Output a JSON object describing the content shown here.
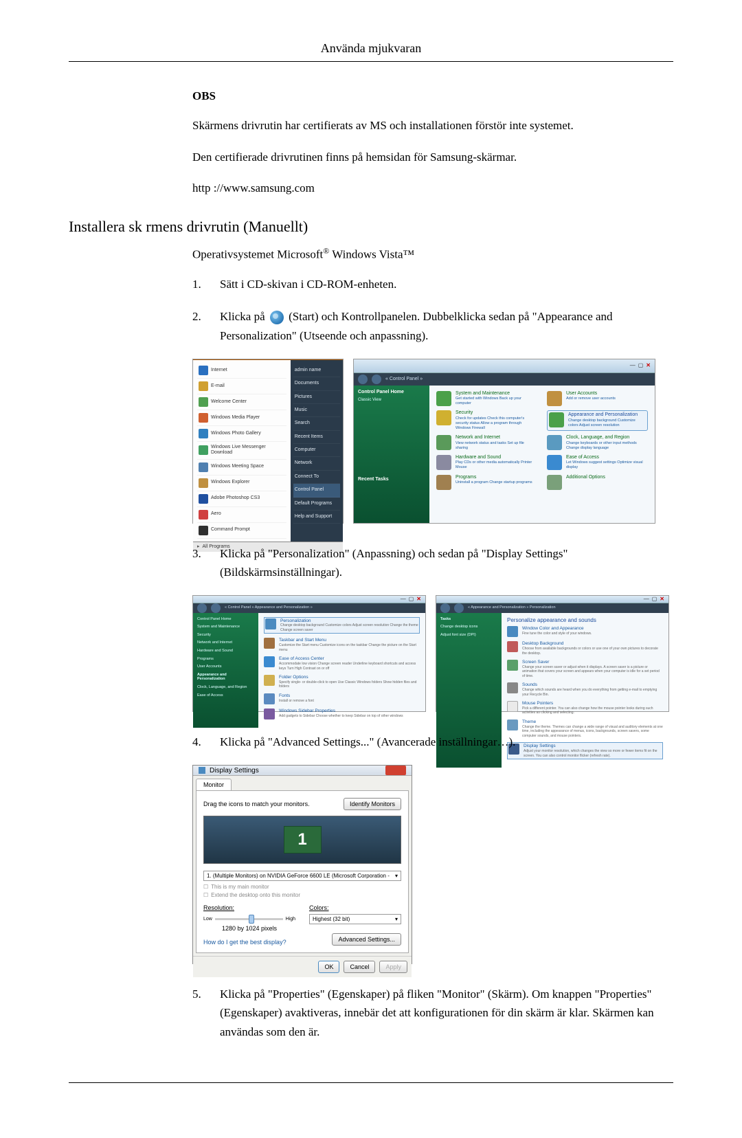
{
  "header": {
    "title": "Använda mjukvaran"
  },
  "obs": {
    "heading": "OBS"
  },
  "p1": "Skärmens drivrutin har certifierats av MS och installationen förstör inte systemet.",
  "p2": "Den certifierade drivrutinen finns på hemsidan för Samsung-skärmar.",
  "p3": "http ://www.samsung.com",
  "h2": "Installera sk rmens drivrutin (Manuellt)",
  "os_prefix": "Operativsystemet Microsoft",
  "os_suffix": " Windows Vista™",
  "steps": {
    "s1": {
      "num": "1.",
      "text": "Sätt i CD-skivan i CD-ROM-enheten."
    },
    "s2": {
      "num": "2.",
      "before_icon": "Klicka på ",
      "after_icon": " (Start) och Kontrollpanelen. Dubbelklicka sedan på \"Appearance and Personalization\" (Utseende och anpassning)."
    },
    "s3": {
      "num": "3.",
      "text": "Klicka på \"Personalization\" (Anpassning) och sedan på \"Display Settings\" (Bildskärmsinställningar)."
    },
    "s4": {
      "num": "4.",
      "text": "Klicka på \"Advanced Settings...\" (Avancerade inställningar…)."
    },
    "s5": {
      "num": "5.",
      "text": "Klicka på \"Properties\" (Egenskaper) på fliken \"Monitor\" (Skärm). Om knappen \"Properties\" (Egenskaper) avaktiveras, innebär det att konfigurationen för din skärm är klar. Skärmen kan användas som den är."
    }
  },
  "startmenu": {
    "items": [
      "Internet",
      "E-mail",
      "Welcome Center",
      "Windows Media Player",
      "Windows Photo Gallery",
      "Windows Live Messenger Download",
      "Windows Meeting Space",
      "Windows Explorer",
      "Adobe Photoshop CS3",
      "Aero",
      "Command Prompt"
    ],
    "right": [
      "admin name",
      "Documents",
      "Pictures",
      "Music",
      "Search",
      "Recent Items",
      "Computer",
      "Network",
      "Connect To",
      "Control Panel",
      "Default Programs",
      "Help and Support"
    ],
    "all_programs": "All Programs"
  },
  "control_panel": {
    "addr": "« Control Panel »",
    "search": "",
    "side": {
      "hd": "Control Panel Home",
      "sub": "Classic View"
    },
    "cats": [
      {
        "title": "System and Maintenance",
        "sub": "Get started with Windows\nBack up your computer"
      },
      {
        "title": "User Accounts",
        "sub": "Add or remove user accounts"
      },
      {
        "title": "Security",
        "sub": "Check for updates\nCheck this computer's security status\nAllow a program through Windows Firewall"
      },
      {
        "title": "Appearance and Personalization",
        "sub": "Change desktop background\nCustomize colors\nAdjust screen resolution"
      },
      {
        "title": "Network and Internet",
        "sub": "View network status and tasks\nSet up file sharing"
      },
      {
        "title": "Clock, Language, and Region",
        "sub": "Change keyboards or other input methods\nChange display language"
      },
      {
        "title": "Hardware and Sound",
        "sub": "Play CDs or other media automatically\nPrinter\nMouse"
      },
      {
        "title": "Ease of Access",
        "sub": "Let Windows suggest settings\nOptimize visual display"
      },
      {
        "title": "Programs",
        "sub": "Uninstall a program\nChange startup programs"
      },
      {
        "title": "Additional Options",
        "sub": ""
      }
    ],
    "recent": "Recent Tasks"
  },
  "pers_left": {
    "addr": "« Control Panel » Appearance and Personalization »",
    "side": [
      "Control Panel Home",
      "System and Maintenance",
      "Security",
      "Network and Internet",
      "Hardware and Sound",
      "Programs",
      "User Accounts",
      "Appearance and Personalization",
      "Clock, Language, and Region",
      "Ease of Access"
    ],
    "items": [
      {
        "title": "Personalization",
        "sub": "Change desktop background   Customize colors   Adjust screen resolution\nChange the theme   Change screen saver"
      },
      {
        "title": "Taskbar and Start Menu",
        "sub": "Customize the Start menu   Customize icons on the taskbar\nChange the picture on the Start menu"
      },
      {
        "title": "Ease of Access Center",
        "sub": "Accommodate low vision   Change screen reader\nUnderline keyboard shortcuts and access keys   Turn High Contrast on or off"
      },
      {
        "title": "Folder Options",
        "sub": "Specify single- or double-click to open   Use Classic Windows folders\nShow hidden files and folders"
      },
      {
        "title": "Fonts",
        "sub": "Install or remove a font"
      },
      {
        "title": "Windows Sidebar Properties",
        "sub": "Add gadgets to Sidebar   Choose whether to keep Sidebar on top of other windows"
      }
    ]
  },
  "pers_right": {
    "addr": "« Appearance and Personalization » Personalization",
    "heading": "Personalize appearance and sounds",
    "items": [
      {
        "title": "Window Color and Appearance",
        "sub": "Fine tune the color and style of your windows."
      },
      {
        "title": "Desktop Background",
        "sub": "Choose from available backgrounds or colors or use one of your own pictures to decorate the desktop."
      },
      {
        "title": "Screen Saver",
        "sub": "Change your screen saver or adjust when it displays. A screen saver is a picture or animation that covers your screen and appears when your computer is idle for a set period of time."
      },
      {
        "title": "Sounds",
        "sub": "Change which sounds are heard when you do everything from getting e-mail to emptying your Recycle Bin."
      },
      {
        "title": "Mouse Pointers",
        "sub": "Pick a different pointer. You can also change how the mouse pointer looks during such activities as clicking and selecting."
      },
      {
        "title": "Theme",
        "sub": "Change the theme. Themes can change a wide range of visual and auditory elements at one time, including the appearance of menus, icons, backgrounds, screen savers, some computer sounds, and mouse pointers."
      },
      {
        "title": "Display Settings",
        "sub": "Adjust your monitor resolution, which changes the view so more or fewer items fit on the screen. You can also control monitor flicker (refresh rate)."
      }
    ],
    "side": [
      "Tasks",
      "Change desktop icons",
      "Adjust font size (DPI)"
    ]
  },
  "display_settings": {
    "title": "Display Settings",
    "tab": "Monitor",
    "drag": "Drag the icons to match your monitors.",
    "identify": "Identify Monitors",
    "mon_num": "1",
    "select": "1. (Multiple Monitors) on NVIDIA GeForce 6600 LE (Microsoft Corporation - ",
    "chk1": "This is my main monitor",
    "chk2": "Extend the desktop onto this monitor",
    "res_label": "Resolution:",
    "low": "Low",
    "high": "High",
    "res_val": "1280 by 1024 pixels",
    "colors_label": "Colors:",
    "colors_val": "Highest (32 bit)",
    "link": "How do I get the best display?",
    "adv": "Advanced Settings...",
    "ok": "OK",
    "cancel": "Cancel",
    "apply": "Apply"
  }
}
